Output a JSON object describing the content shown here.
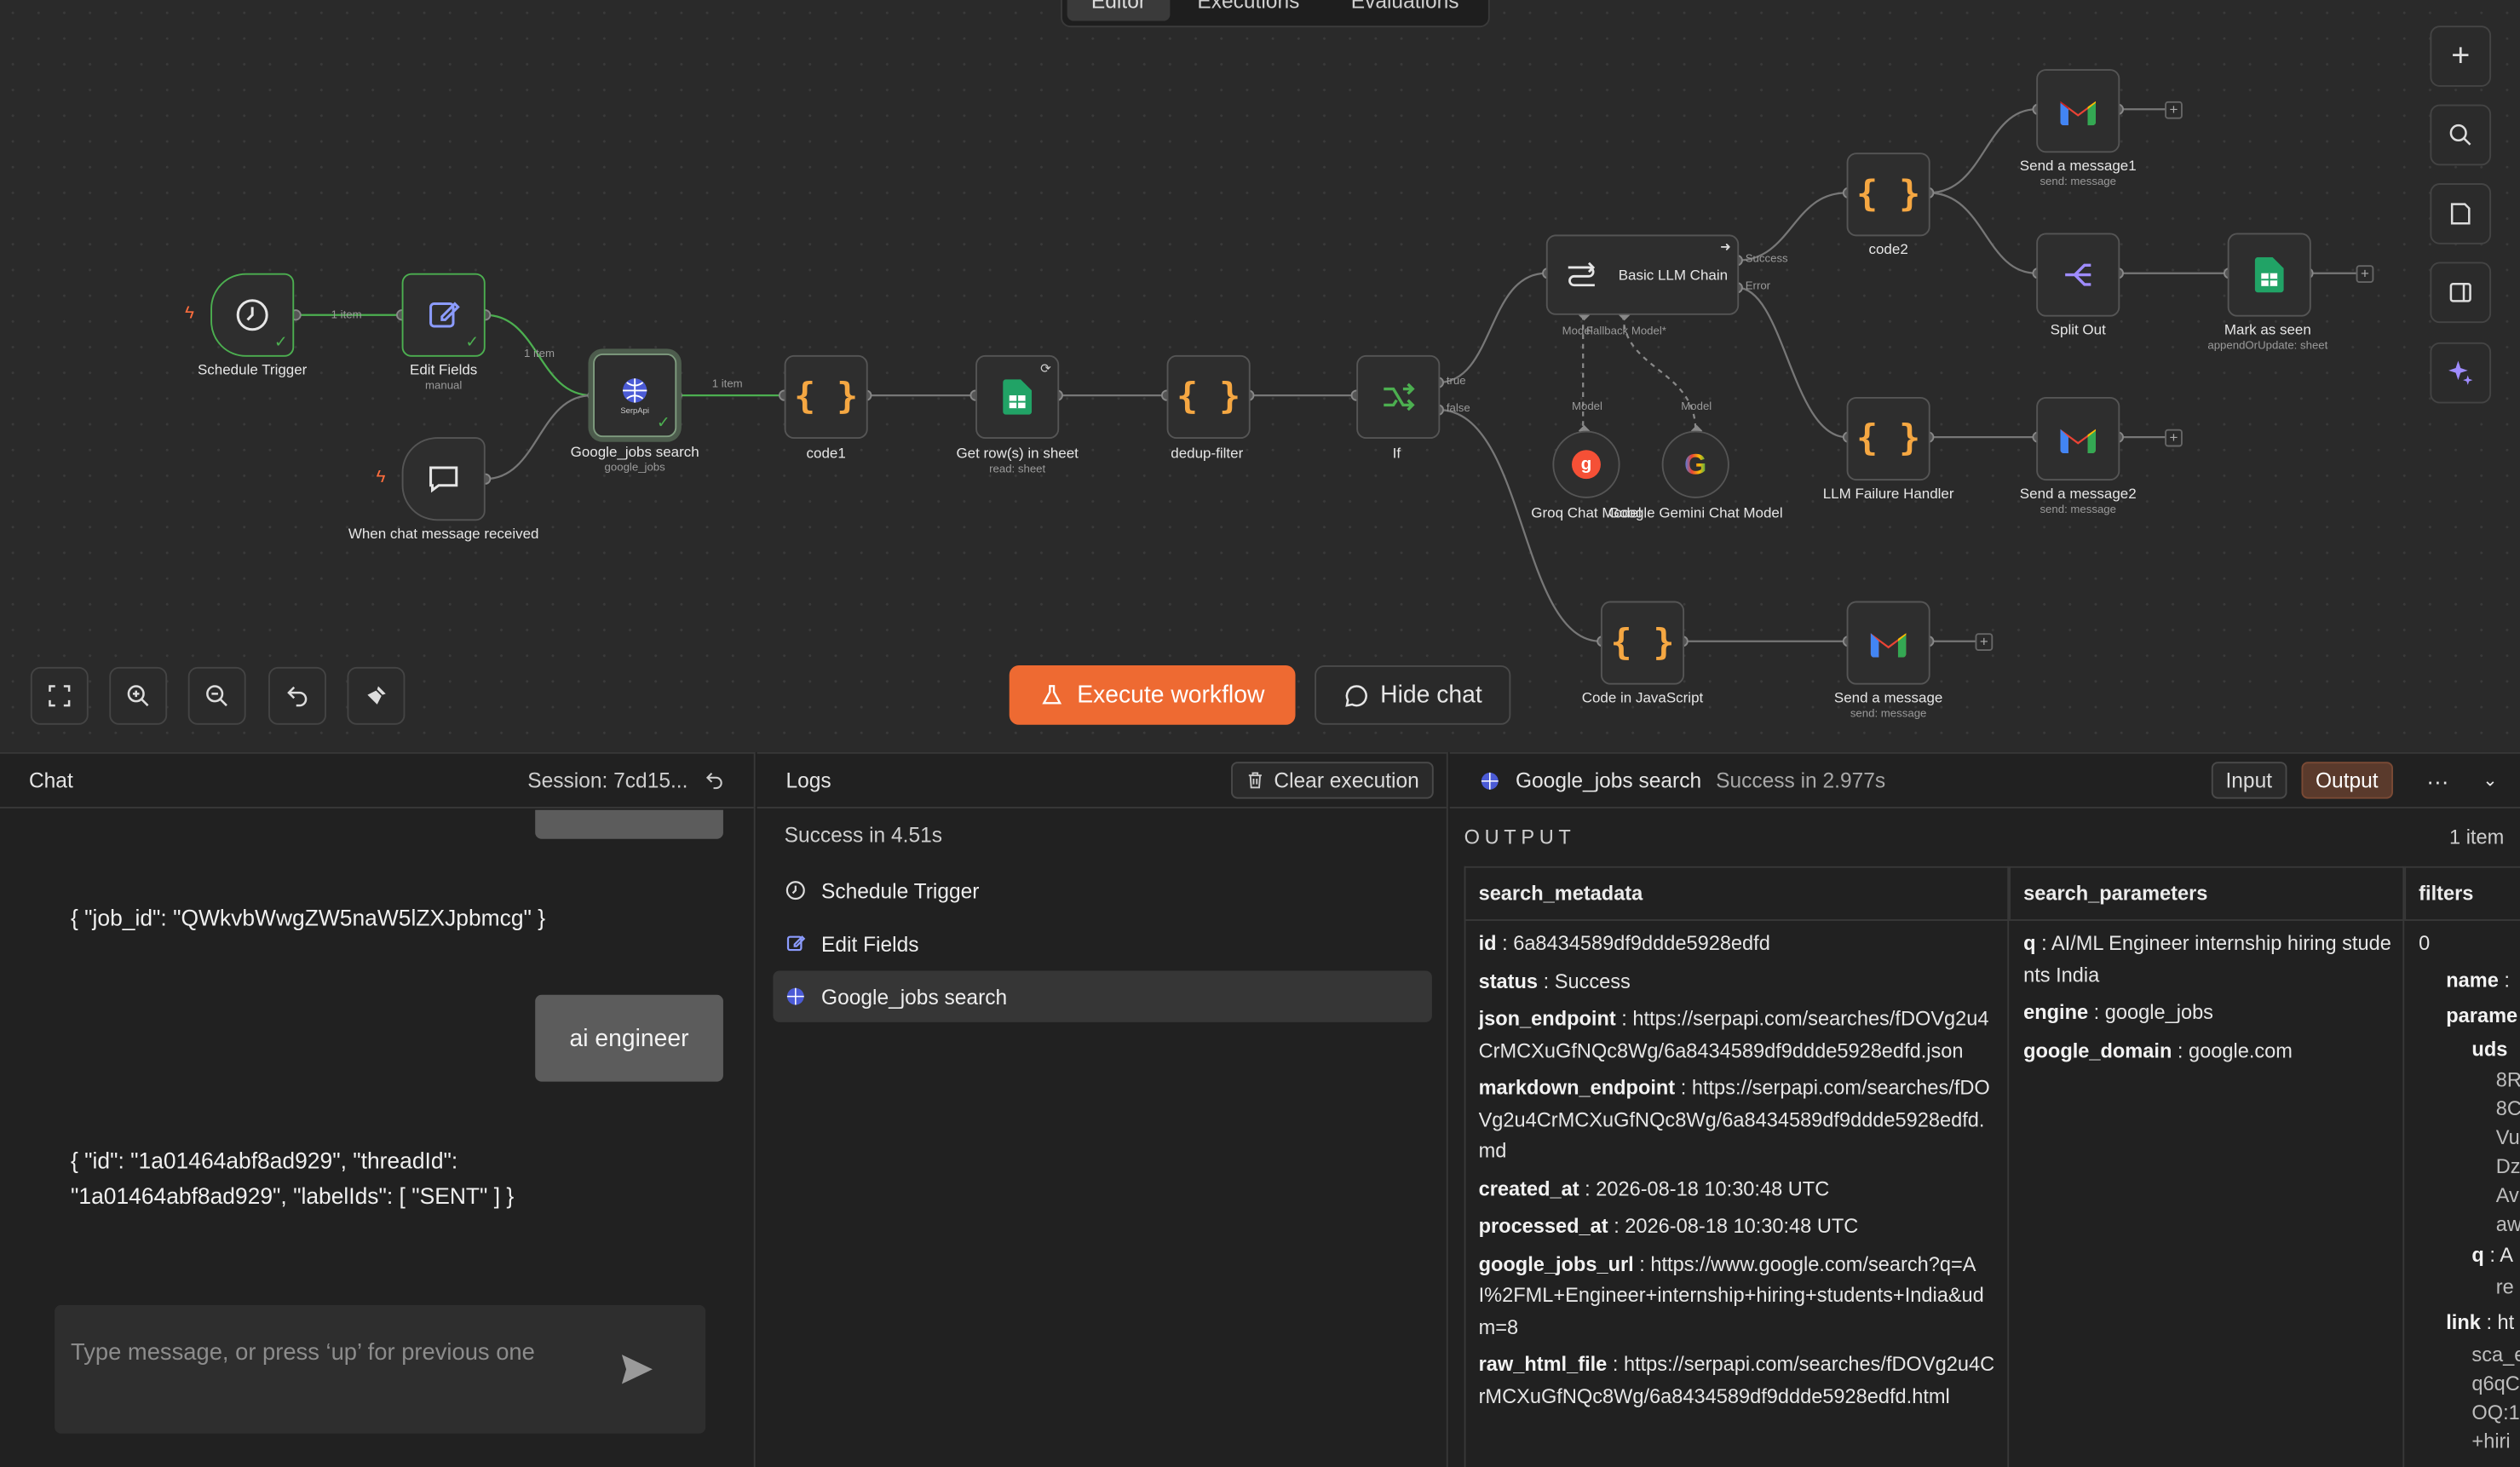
{
  "tabs": {
    "editor": "Editor",
    "executions": "Executions",
    "evaluations": "Evaluations"
  },
  "nodes": {
    "schedule": {
      "label": "Schedule Trigger"
    },
    "edit": {
      "label": "Edit Fields",
      "sub": "manual"
    },
    "chat_trigger": {
      "label": "When chat message received"
    },
    "google_jobs": {
      "label": "Google_jobs search",
      "sub": "google_jobs",
      "icon_text": "SerpApi"
    },
    "code1": {
      "label": "code1"
    },
    "get_rows": {
      "label": "Get row(s) in sheet",
      "sub": "read: sheet"
    },
    "dedup": {
      "label": "dedup-filter"
    },
    "if": {
      "label": "If",
      "true": "true",
      "false": "false"
    },
    "llm_chain": {
      "label": "Basic LLM Chain",
      "success": "Success",
      "error": "Error",
      "model_label": "Model",
      "fallback_label": "Fallback Model*"
    },
    "groq": {
      "label": "Groq Chat Model",
      "conn": "Model"
    },
    "gemini": {
      "label": "Google Gemini Chat Model",
      "conn": "Model"
    },
    "code2": {
      "label": "code2"
    },
    "send1": {
      "label": "Send a message1",
      "sub": "send: message"
    },
    "split": {
      "label": "Split Out"
    },
    "mark_seen": {
      "label": "Mark as seen",
      "sub": "appendOrUpdate: sheet"
    },
    "llm_fail": {
      "label": "LLM Failure Handler"
    },
    "send2": {
      "label": "Send a message2",
      "sub": "send: message"
    },
    "code_js": {
      "label": "Code in JavaScript"
    },
    "send": {
      "label": "Send a message",
      "sub": "send: message"
    }
  },
  "edges": {
    "e1": "1 item",
    "e2": "1 item",
    "e3": "1 item"
  },
  "toolbar": {
    "execute": "Execute workflow",
    "hide_chat": "Hide chat"
  },
  "chat": {
    "title": "Chat",
    "session": "Session: 7cd15...",
    "messages": [
      "{ \"job_id\": \"QWkvbWwgZW5naW5lZXJpbmcg\" }",
      "ai engineer",
      "{ \"id\": \"1a01464abf8ad929\", \"threadId\": \"1a01464abf8ad929\", \"labelIds\": [ \"SENT\" ] }"
    ],
    "placeholder": "Type message, or press ‘up’ for previous one"
  },
  "logs": {
    "title": "Logs",
    "clear": "Clear execution",
    "status": "Success in 4.51s",
    "items": [
      "Schedule Trigger",
      "Edit Fields",
      "Google_jobs search"
    ]
  },
  "output": {
    "node": "Google_jobs search",
    "status": "Success in 2.977s",
    "input_btn": "Input",
    "output_btn": "Output",
    "title": "OUTPUT",
    "count": "1 item",
    "columns": [
      "search_metadata",
      "search_parameters",
      "filters"
    ],
    "metadata": [
      {
        "k": "id",
        "v": "6a8434589df9ddde5928edfd"
      },
      {
        "k": "status",
        "v": "Success"
      },
      {
        "k": "json_endpoint",
        "v": "https://serpapi.com/searches/fDOVg2u4CrMCXuGfNQc8Wg/6a8434589df9ddde5928edfd.json"
      },
      {
        "k": "markdown_endpoint",
        "v": "https://serpapi.com/searches/fDOVg2u4CrMCXuGfNQc8Wg/6a8434589df9ddde5928edfd.md"
      },
      {
        "k": "created_at",
        "v": "2026-08-18 10:30:48 UTC"
      },
      {
        "k": "processed_at",
        "v": "2026-08-18 10:30:48 UTC"
      },
      {
        "k": "google_jobs_url",
        "v": "https://www.google.com/search?q=AI%2FML+Engineer+internship+hiring+students+India&udm=8"
      },
      {
        "k": "raw_html_file",
        "v": "https://serpapi.com/searches/fDOVg2u4CrMCXuGfNQc8Wg/6a8434589df9ddde5928edfd.html"
      }
    ],
    "parameters": [
      {
        "k": "q",
        "v": "AI/ML Engineer internship hiring students India"
      },
      {
        "k": "engine",
        "v": "google_jobs"
      },
      {
        "k": "google_domain",
        "v": "google.com"
      }
    ],
    "filters": {
      "index": "0",
      "name": "name",
      "params": "parame",
      "uds": "uds",
      "uds_lines": [
        "8R",
        "8C",
        "Vu",
        "Dz",
        "Av",
        "aw"
      ],
      "q": "q",
      "q_lines": [
        "A",
        "re"
      ],
      "link": "link",
      "link_lines": [
        "ht",
        "sca_e",
        "q6qC",
        "OQ:1",
        "+hiri"
      ]
    }
  },
  "colors": {
    "accent": "#ee6a32",
    "success": "#4caf50",
    "canvas": "#2a2a2a",
    "panel": "#212121"
  }
}
